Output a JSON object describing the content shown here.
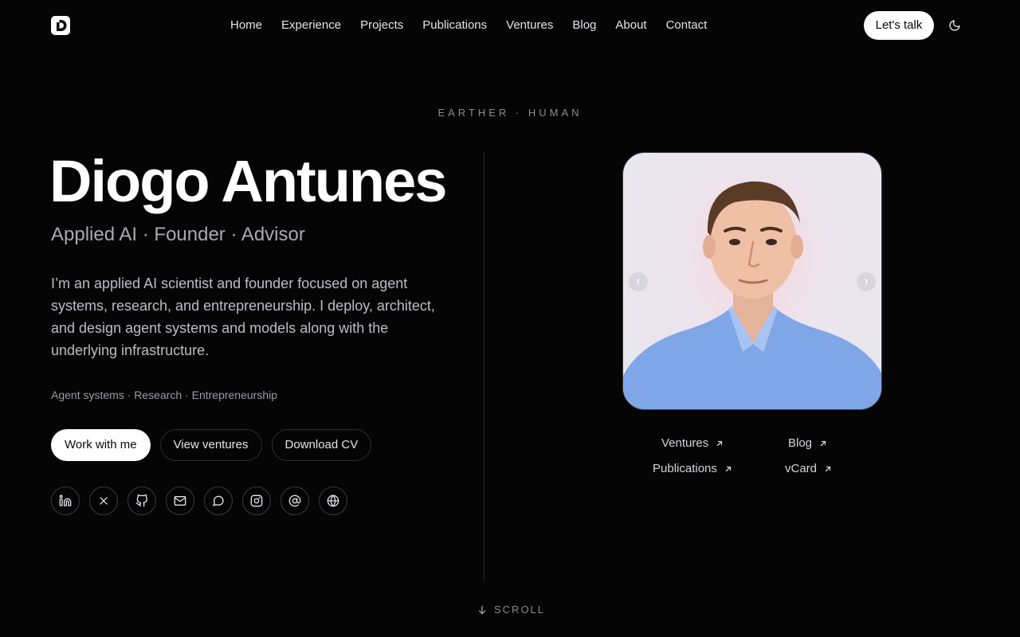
{
  "nav": {
    "links": [
      "Home",
      "Experience",
      "Projects",
      "Publications",
      "Ventures",
      "Blog",
      "About",
      "Contact"
    ],
    "cta_label": "Let's talk",
    "logo_icon": "d-monogram-logo",
    "theme_icon": "moon-icon"
  },
  "hero": {
    "eyebrow": "EARTHER · HUMAN",
    "name": "Diogo Antunes",
    "tagline": "Applied AI · Founder · Advisor",
    "bio": "I’m an applied AI scientist and founder focused on agent systems, research, and entrepreneurship. I deploy, architect, and design agent systems and models along with the underlying infrastructure.",
    "topics": "Agent systems · Research · Entrepreneurship",
    "buttons": {
      "primary": "Work with me",
      "ventures": "View ventures",
      "cv": "Download CV"
    },
    "socials": [
      "linkedin-icon",
      "x-icon",
      "github-icon",
      "mail-icon",
      "chat-icon",
      "instagram-icon",
      "at-sign-icon",
      "globe-icon"
    ]
  },
  "portrait": {
    "prev_icon": "chevron-left-icon",
    "next_icon": "chevron-right-icon"
  },
  "quick_links": {
    "ventures": "Ventures",
    "blog": "Blog",
    "publications": "Publications",
    "vcard": "vCard"
  },
  "scroll_label": "SCROLL",
  "colors": {
    "background": "#050506",
    "text": "#f4f4f5",
    "muted": "#8a8a90",
    "shirt": "#7fa6e6"
  }
}
